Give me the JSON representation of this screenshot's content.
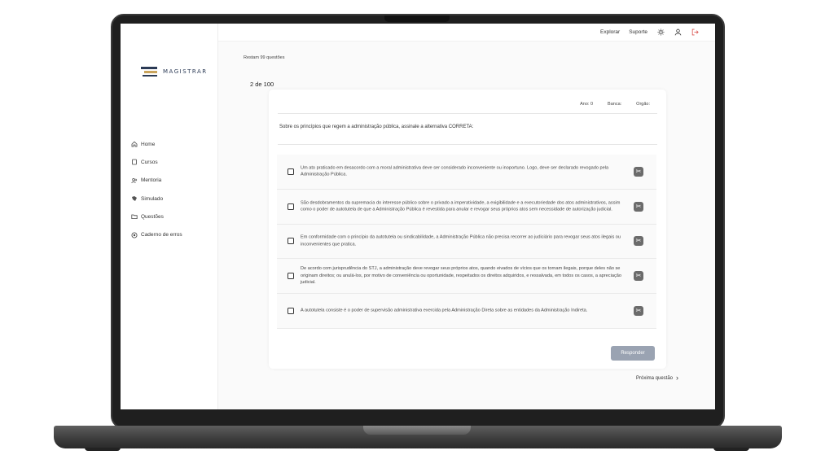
{
  "brand": {
    "logo_text": "MAGISTRAR"
  },
  "topbar": {
    "links": [
      "Explorar",
      "Suporte"
    ],
    "icons": [
      "sun-icon",
      "user-icon",
      "logout-icon"
    ]
  },
  "sidebar": {
    "items": [
      {
        "label": "Home",
        "icon": "home-icon"
      },
      {
        "label": "Cursos",
        "icon": "book-icon"
      },
      {
        "label": "Mentoria",
        "icon": "people-icon"
      },
      {
        "label": "Simulado",
        "icon": "bookmark-icon"
      },
      {
        "label": "Questões",
        "icon": "folder-icon"
      },
      {
        "label": "Caderno de erros",
        "icon": "error-circle-icon"
      }
    ]
  },
  "progress": {
    "remaining": "Restam 99 questões",
    "counter": "2 de 100"
  },
  "question": {
    "meta": {
      "ano": "Ano: 0",
      "banca": "Banca:",
      "orgao": "Orgão:"
    },
    "statement": "Sobre os princípios que regem a administração pública, assinale a alternativa CORRETA:",
    "options": [
      "Um ato praticado em desacordo com a moral administrativa deve ser considerado inconveniente ou inoportuno. Logo, deve ser declarado revogado pela Administração Pública.",
      "São desdobramentos da supremacia do interesse público sobre o privado a imperatividade, a exigibilidade e a executoriedade dos atos administrativos, assim como o poder de autotutela de que a Administração Pública é revestida para anular e revogar seus próprios atos sem necessidade de autorização judicial.",
      "Em conformidade com o princípio da autotutela ou sindicabilidade, a Administração Pública não precisa recorrer ao judiciário para revogar seus atos ilegais ou inconvenientes que pratica.",
      "De acordo com jurisprudência do STJ, a administração deve revogar seus próprios atos, quando eivados de vícios que os tornam ilegais, porque deles não se originam direitos; ou anulá-los, por motivo de conveniência ou oportunidade, respeitados os direitos adquiridos, e ressalvada, em todos os casos, a apreciação judicial.",
      "A autotutela consiste é o poder de supervisão administrativa exercida pela Administração Direta sobre as entidades da Administração Indireta."
    ],
    "answer_label": "Responder"
  },
  "next_label": "Próxima questão",
  "colors": {
    "brand_navy": "#2b3a55",
    "brand_gold": "#c9a45c",
    "button_disabled": "#9aa3b2",
    "logout": "#d9534f"
  }
}
